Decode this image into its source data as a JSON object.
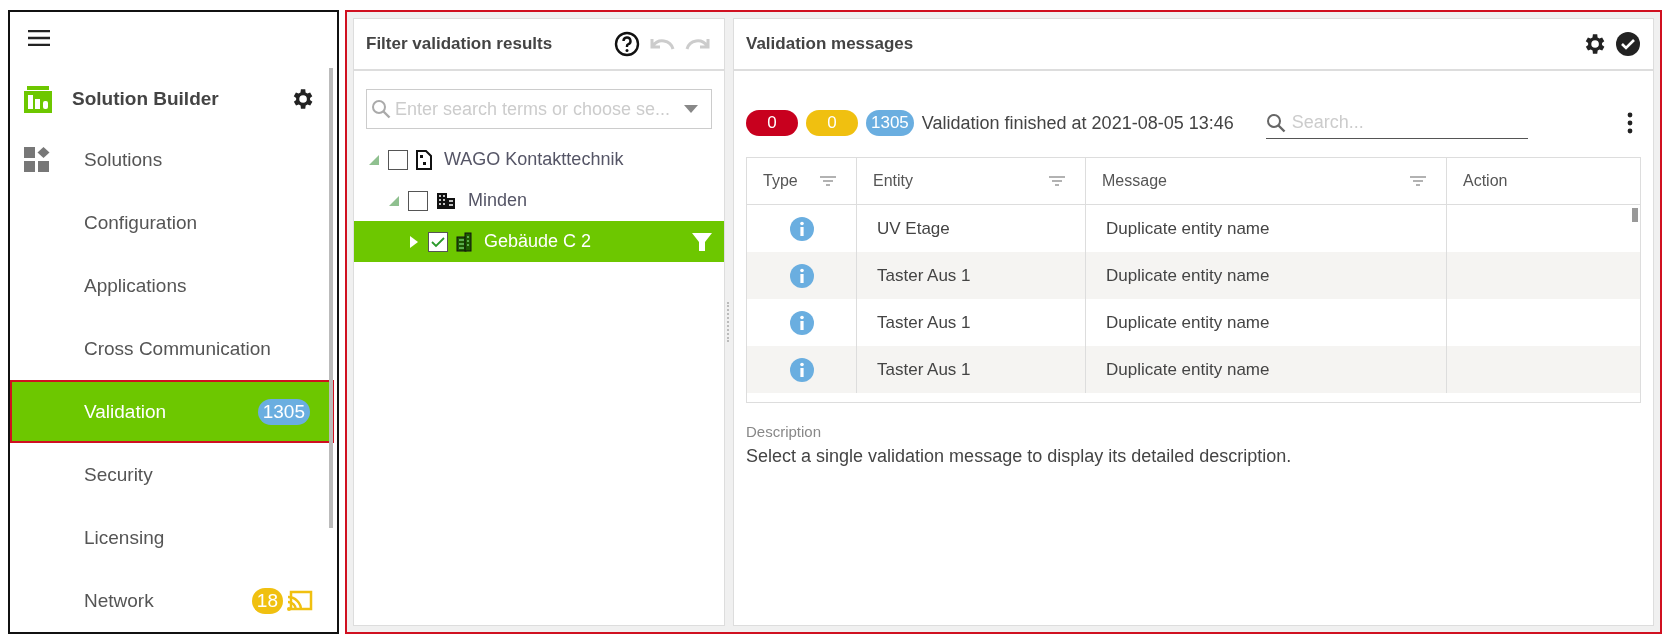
{
  "sidebar": {
    "brand": "Solution Builder",
    "items": [
      {
        "label": "Solutions",
        "selected": false
      },
      {
        "label": "Configuration",
        "selected": false
      },
      {
        "label": "Applications",
        "selected": false
      },
      {
        "label": "Cross Communication",
        "selected": false
      },
      {
        "label": "Validation",
        "selected": true,
        "badge": {
          "text": "1305",
          "color": "#6aaee0"
        }
      },
      {
        "label": "Security",
        "selected": false
      },
      {
        "label": "Licensing",
        "selected": false
      },
      {
        "label": "Network",
        "selected": false,
        "badge": {
          "text": "18",
          "color": "#f0c010"
        }
      }
    ]
  },
  "filter": {
    "title": "Filter validation results",
    "search": {
      "placeholder": "Enter search terms or choose se..."
    },
    "tree": [
      {
        "label": "WAGO Kontakttechnik",
        "expanded": true,
        "checked": false,
        "selected": false,
        "children": [
          {
            "label": "Minden",
            "expanded": true,
            "checked": false,
            "selected": false,
            "children": [
              {
                "label": "Gebäude C 2",
                "expanded": false,
                "checked": true,
                "selected": true
              }
            ]
          }
        ]
      }
    ]
  },
  "messages": {
    "title": "Validation messages",
    "counts": [
      {
        "text": "0",
        "color": "#c8001e"
      },
      {
        "text": "0",
        "color": "#f0c010"
      },
      {
        "text": "1305",
        "color": "#6aaee0"
      }
    ],
    "status": "Validation finished at 2021-08-05 13:46",
    "search": {
      "placeholder": "Search..."
    },
    "table": {
      "columns": [
        {
          "label": "Type",
          "filter": true
        },
        {
          "label": "Entity",
          "filter": true
        },
        {
          "label": "Message",
          "filter": true
        },
        {
          "label": "Action",
          "filter": false
        }
      ],
      "rows": [
        {
          "kind": "info",
          "entity": "UV Etage",
          "message": "Duplicate entity name"
        },
        {
          "kind": "info",
          "entity": "Taster Aus 1",
          "message": "Duplicate entity name"
        },
        {
          "kind": "info",
          "entity": "Taster Aus 1",
          "message": "Duplicate entity name"
        },
        {
          "kind": "info",
          "entity": "Taster Aus 1",
          "message": "Duplicate entity name"
        }
      ]
    },
    "description": {
      "label": "Description",
      "text": "Select a single validation message to display its detailed description."
    }
  }
}
